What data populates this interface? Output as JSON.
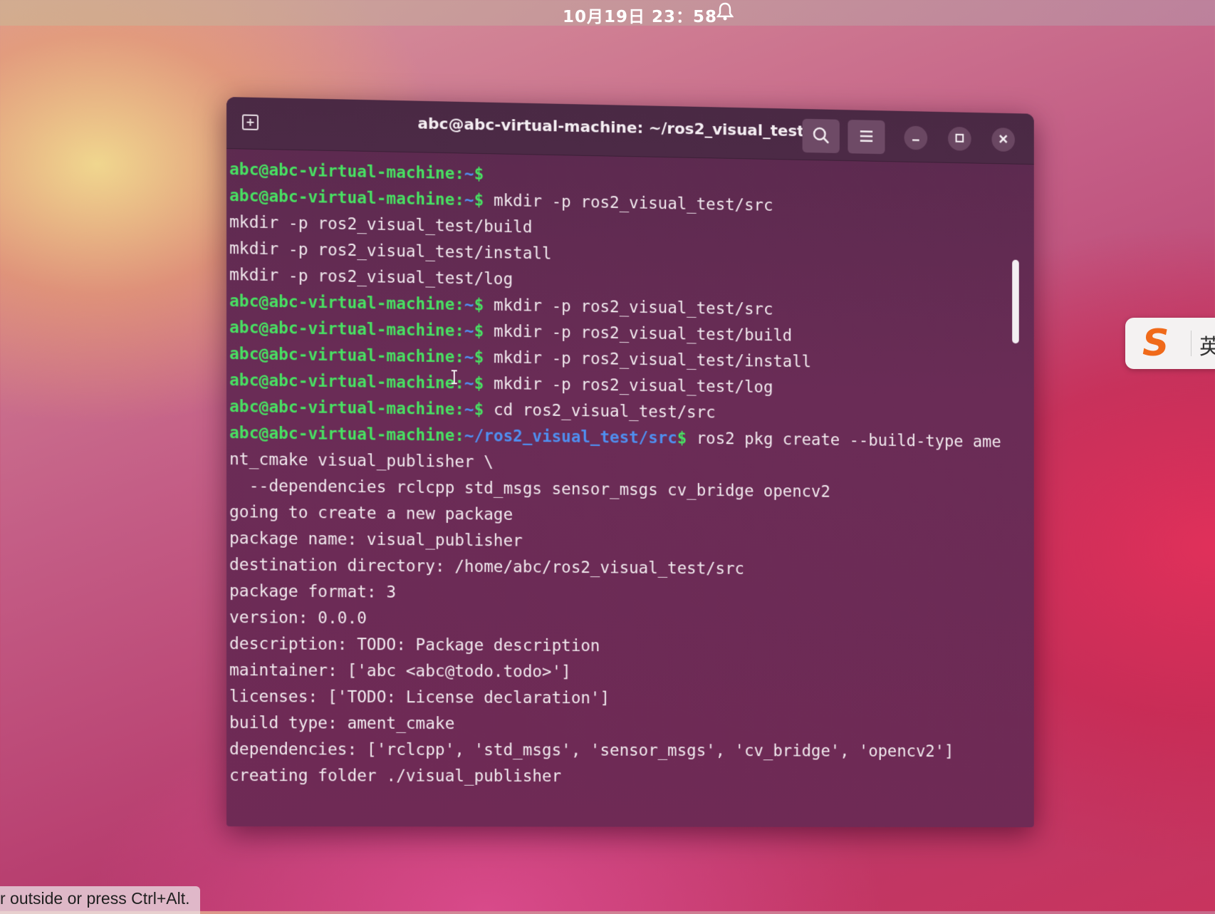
{
  "topbar": {
    "datetime": "10月19日 23：58",
    "notification_icon": "bell-icon"
  },
  "terminal": {
    "title": "abc@abc-virtual-machine: ~/ros2_visual_test",
    "buttons": {
      "new_tab_icon": "new-tab-icon",
      "search_icon": "search-icon",
      "menu_icon": "hamburger-menu-icon",
      "minimize_icon": "minimize-icon",
      "maximize_icon": "maximize-icon",
      "close_icon": "close-icon"
    },
    "colors": {
      "prompt_user": "#48e062",
      "prompt_path": "#4f8ff0",
      "background": "#6a2c56"
    },
    "lines": [
      {
        "user": "abc@abc-virtual-machine",
        "sep": ":",
        "path": "~",
        "dollar": "$",
        "cmd": ""
      },
      {
        "user": "abc@abc-virtual-machine",
        "sep": ":",
        "path": "~",
        "dollar": "$",
        "cmd": " mkdir -p ros2_visual_test/src"
      },
      {
        "text": "mkdir -p ros2_visual_test/build"
      },
      {
        "text": "mkdir -p ros2_visual_test/install"
      },
      {
        "text": "mkdir -p ros2_visual_test/log"
      },
      {
        "user": "abc@abc-virtual-machine",
        "sep": ":",
        "path": "~",
        "dollar": "$",
        "cmd": " mkdir -p ros2_visual_test/src"
      },
      {
        "user": "abc@abc-virtual-machine",
        "sep": ":",
        "path": "~",
        "dollar": "$",
        "cmd": " mkdir -p ros2_visual_test/build"
      },
      {
        "user": "abc@abc-virtual-machine",
        "sep": ":",
        "path": "~",
        "dollar": "$",
        "cmd": " mkdir -p ros2_visual_test/install"
      },
      {
        "user": "abc@abc-virtual-machine",
        "sep": ":",
        "path": "~",
        "dollar": "$",
        "cmd": " mkdir -p ros2_visual_test/log"
      },
      {
        "user": "abc@abc-virtual-machine",
        "sep": ":",
        "path": "~",
        "dollar": "$",
        "cmd": " cd ros2_visual_test/src"
      },
      {
        "user": "abc@abc-virtual-machine",
        "sep": ":",
        "path": "~/ros2_visual_test/src",
        "dollar": "$",
        "cmd": " ros2 pkg create --build-type ame"
      },
      {
        "text": "nt_cmake visual_publisher \\"
      },
      {
        "text": "  --dependencies rclcpp std_msgs sensor_msgs cv_bridge opencv2"
      },
      {
        "text": "going to create a new package"
      },
      {
        "text": "package name: visual_publisher"
      },
      {
        "text": "destination directory: /home/abc/ros2_visual_test/src"
      },
      {
        "text": "package format: 3"
      },
      {
        "text": "version: 0.0.0"
      },
      {
        "text": "description: TODO: Package description"
      },
      {
        "text": "maintainer: ['abc <abc@todo.todo>']"
      },
      {
        "text": "licenses: ['TODO: License declaration']"
      },
      {
        "text": "build type: ament_cmake"
      },
      {
        "text": "dependencies: ['rclcpp', 'std_msgs', 'sensor_msgs', 'cv_bridge', 'opencv2']"
      },
      {
        "text": "creating folder ./visual_publisher"
      }
    ]
  },
  "ime": {
    "logo": "S",
    "mode": "英"
  },
  "hint": {
    "text": "r outside or press Ctrl+Alt."
  }
}
